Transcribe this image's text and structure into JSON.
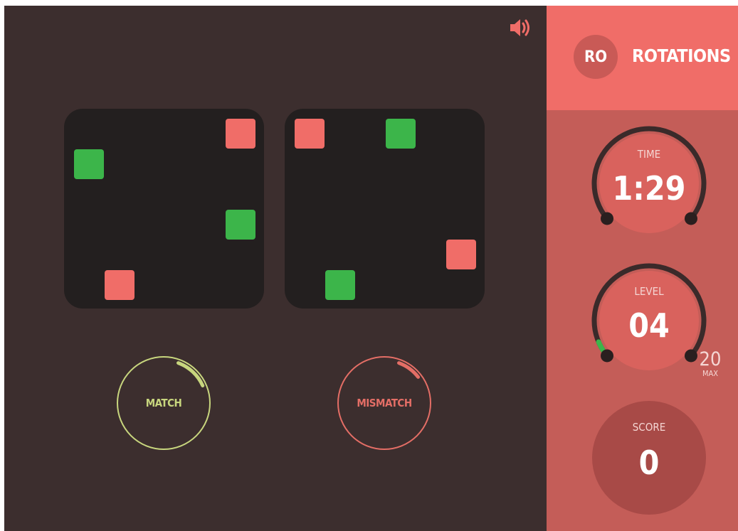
{
  "brand": {
    "badge": "RO",
    "title": "ROTATIONS"
  },
  "colors": {
    "stage": "#3c2e2e",
    "board": "#231f1f",
    "tile_red": "#f06d68",
    "tile_green": "#3cb54a",
    "sidebar": "#c45d58",
    "header": "#f06d68",
    "match": "#c8d67e",
    "mismatch": "#e46e66"
  },
  "icons": {
    "sound": "speaker-icon"
  },
  "boards": {
    "left": [
      {
        "color": "red",
        "row": 0,
        "col": 5
      },
      {
        "color": "green",
        "row": 1,
        "col": 0
      },
      {
        "color": "green",
        "row": 3,
        "col": 5
      },
      {
        "color": "red",
        "row": 5,
        "col": 1
      }
    ],
    "right": [
      {
        "color": "red",
        "row": 0,
        "col": 0
      },
      {
        "color": "green",
        "row": 0,
        "col": 3
      },
      {
        "color": "red",
        "row": 4,
        "col": 5
      },
      {
        "color": "green",
        "row": 5,
        "col": 1
      }
    ]
  },
  "buttons": {
    "match": {
      "label": "MATCH",
      "progress": 0.17
    },
    "mismatch": {
      "label": "MISMATCH",
      "progress": 0.12
    }
  },
  "stats": {
    "time": {
      "label": "TIME",
      "value": "1:29"
    },
    "level": {
      "label": "LEVEL",
      "value": "04",
      "max": "20",
      "max_label": "MAX",
      "progress": 0.2
    },
    "score": {
      "label": "SCORE",
      "value": "0"
    }
  }
}
